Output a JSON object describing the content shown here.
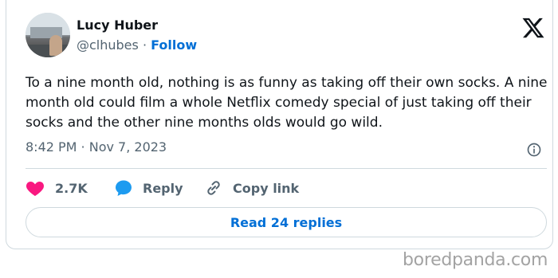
{
  "author": {
    "name": "Lucy Huber",
    "handle": "@clhubes",
    "separator": "·",
    "follow_label": "Follow"
  },
  "tweet": {
    "text": "To a nine month old, nothing is as funny as taking off their own socks. A nine month old could film a whole Netflix comedy special of just taking off their socks and the other nine months olds would go wild.",
    "timestamp": "8:42 PM · Nov 7, 2023"
  },
  "actions": {
    "likes": "2.7K",
    "reply_label": "Reply",
    "copy_link_label": "Copy link"
  },
  "read_replies_label": "Read 24 replies",
  "watermark": "boredpanda.com",
  "colors": {
    "text": "#0f1419",
    "secondary": "#536471",
    "link_blue": "#006fd6",
    "heart": "#f91880",
    "reply_bubble": "#1d9bf0",
    "border": "#cfd9de"
  },
  "icons": [
    "x-logo-icon",
    "info-icon",
    "heart-icon",
    "reply-bubble-icon",
    "link-icon"
  ]
}
